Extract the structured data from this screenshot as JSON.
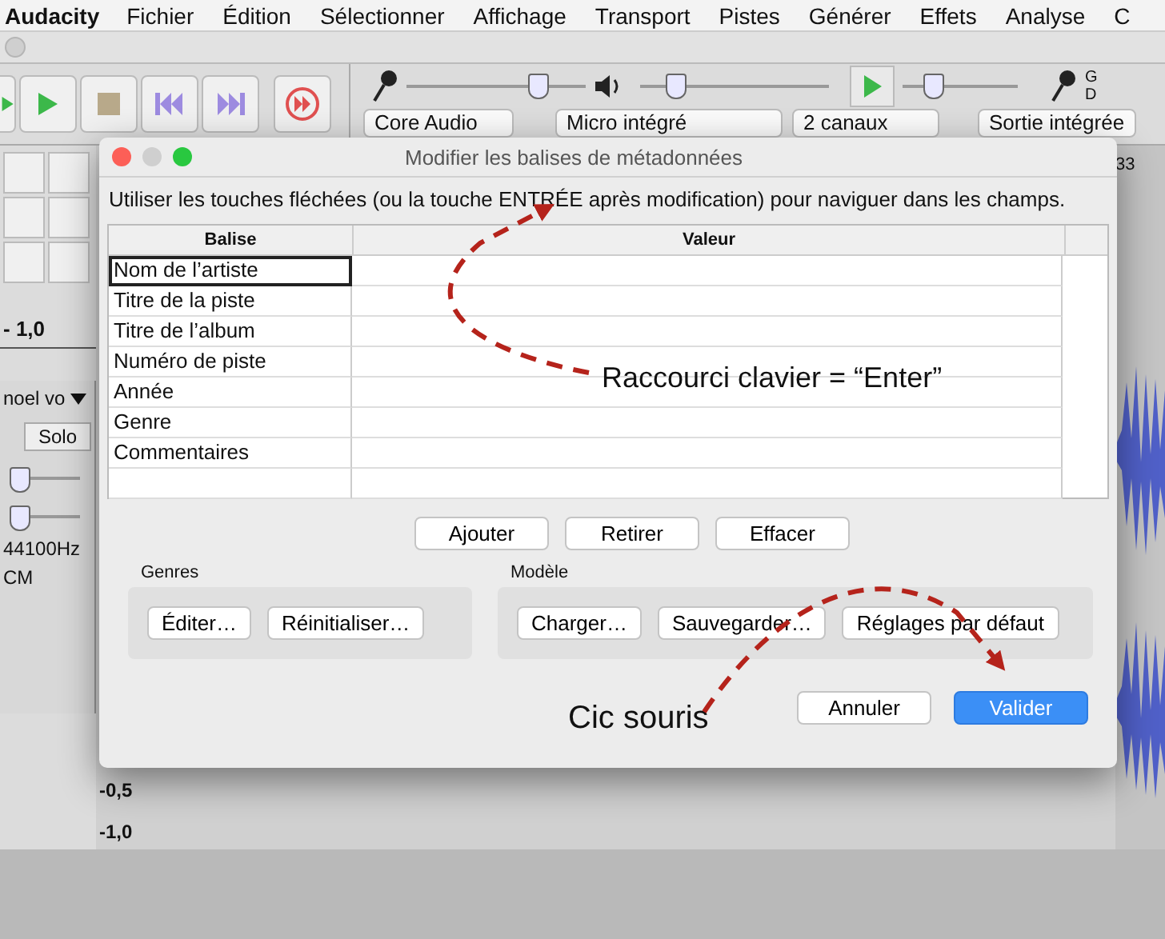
{
  "menu_bar": {
    "app_name": "Audacity",
    "items": [
      "Fichier",
      "Édition",
      "Sélectionner",
      "Affichage",
      "Transport",
      "Pistes",
      "Générer",
      "Effets",
      "Analyse",
      "C"
    ]
  },
  "toolbar": {
    "record_volume": {
      "level": 0.72
    },
    "playback_volume": {
      "level": 0.18
    },
    "play_speed": {
      "level": 0.25
    },
    "meter_labels": [
      "G",
      "D"
    ],
    "host": "Core Audio",
    "input_device": "Micro intégré",
    "channels": "2 canaux",
    "output_device": "Sortie intégrée"
  },
  "ruler": {
    "left_value": "- 1,0",
    "right_value": "33"
  },
  "track": {
    "name": "noel vo",
    "solo": "Solo",
    "gain": {
      "level": 0.0
    },
    "pan": {
      "level": 0.0
    },
    "rate": "44100Hz",
    "format": "CM",
    "scale": [
      "-0,5",
      "-1,0"
    ]
  },
  "dialog": {
    "title": "Modifier les balises de métadonnées",
    "instructions": "Utiliser les touches fléchées (ou la touche ENTRÉE après modification) pour naviguer dans les champs.",
    "columns": [
      "Balise",
      "Valeur"
    ],
    "rows": [
      {
        "tag": "Nom de l’artiste",
        "selected": true
      },
      {
        "tag": "Titre de la piste",
        "selected": false
      },
      {
        "tag": "Titre de l’album",
        "selected": false
      },
      {
        "tag": "Numéro de piste",
        "selected": false
      },
      {
        "tag": "Année",
        "selected": false
      },
      {
        "tag": "Genre",
        "selected": false
      },
      {
        "tag": "Commentaires",
        "selected": false
      }
    ],
    "table_buttons": [
      "Ajouter",
      "Retirer",
      "Effacer"
    ],
    "groups": [
      {
        "title": "Genres",
        "buttons": [
          "Éditer…",
          "Réinitialiser…"
        ]
      },
      {
        "title": "Modèle",
        "buttons": [
          "Charger…",
          "Sauvegarder…",
          "Réglages par défaut"
        ]
      }
    ],
    "footer_buttons": [
      {
        "label": "Annuler",
        "default": false
      },
      {
        "label": "Valider",
        "default": true
      }
    ]
  },
  "annotations": [
    {
      "text": "Raccourci clavier = “Enter”",
      "kind": "keyboard"
    },
    {
      "text": "Cic souris",
      "kind": "mouse"
    }
  ]
}
